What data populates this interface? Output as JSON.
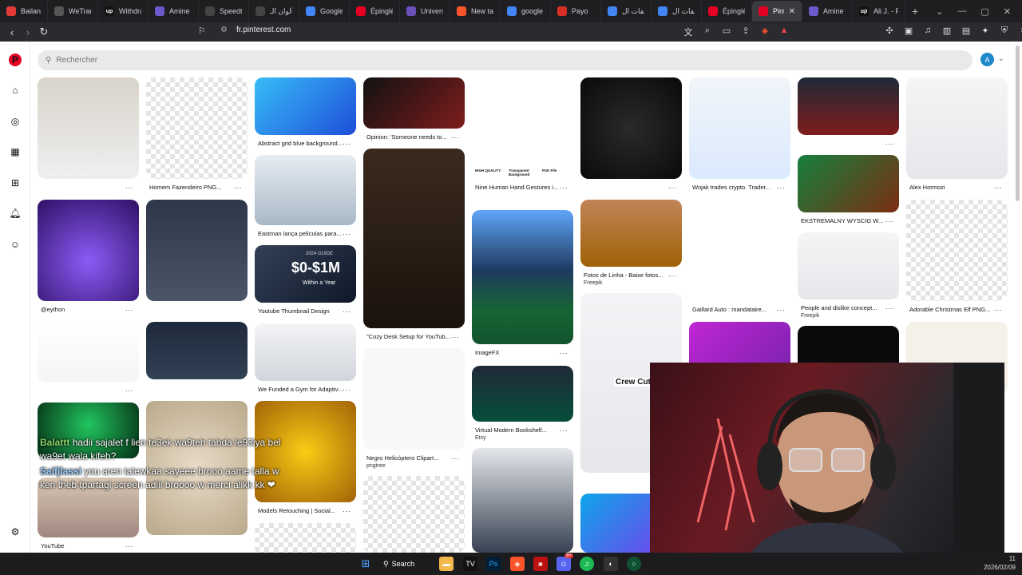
{
  "browser": {
    "tabs": [
      {
        "title": "Bailand",
        "color": "#e53935"
      },
      {
        "title": "WeTrans",
        "color": "#555"
      },
      {
        "title": "Withdra",
        "color": "#111",
        "icon": "up"
      },
      {
        "title": "Amine D",
        "color": "#6a5acd"
      },
      {
        "title": "Speedte",
        "color": "#444"
      },
      {
        "title": "ألوان الـ",
        "color": "#444"
      },
      {
        "title": "Google",
        "color": "#4285f4"
      },
      {
        "title": "Épinglé",
        "color": "#e60023"
      },
      {
        "title": "Univers",
        "color": "#6b4fbb"
      },
      {
        "title": "New tab",
        "color": "#fb542b"
      },
      {
        "title": "google t",
        "color": "#4285f4"
      },
      {
        "title": "Payo",
        "color": "#d93025"
      },
      {
        "title": "ملفات ال",
        "color": "#4285f4"
      },
      {
        "title": "ملفات ال",
        "color": "#4285f4"
      },
      {
        "title": "Épinglé",
        "color": "#e60023"
      },
      {
        "title": "Pint",
        "color": "#e60023",
        "active": true
      },
      {
        "title": "Amine D",
        "color": "#6a5acd"
      },
      {
        "title": "Ali J. - F",
        "color": "#111",
        "icon": "up"
      }
    ],
    "url": "fr.pinterest.com",
    "shield_badge": "1"
  },
  "pinterest": {
    "search_placeholder": "Rechercher",
    "avatar_letter": "A",
    "more_label": "...",
    "pins": [
      {
        "caption": "",
        "sub": ""
      },
      {
        "caption": "Homem Fazendeiro PNG...",
        "sub": ""
      },
      {
        "caption": "@eython",
        "sub": ""
      },
      {
        "caption": "",
        "sub": ""
      },
      {
        "caption": "",
        "sub": ""
      },
      {
        "caption": "YouTube",
        "sub": ""
      },
      {
        "caption": "",
        "sub": ""
      },
      {
        "caption": "",
        "sub": ""
      },
      {
        "caption": "",
        "sub": ""
      },
      {
        "caption": "Abstract grid blue background...",
        "sub": ""
      },
      {
        "caption": "Eastman lança películas para...",
        "sub": ""
      },
      {
        "caption": "Youtube Thumbnail Design",
        "sub": ""
      },
      {
        "caption": "We Funded a Gym for Adaptiv...",
        "sub": ""
      },
      {
        "caption": "Models Retouching | Social...",
        "sub": ""
      },
      {
        "caption": "",
        "sub": ""
      },
      {
        "caption": "Opinion: 'Someone needs to...",
        "sub": ""
      },
      {
        "caption": "\"Cozy Desk Setup for YouTub...",
        "sub": ""
      },
      {
        "caption": "Negro Helicóptero Clipart...",
        "sub": "pngtree"
      },
      {
        "caption": "",
        "sub": ""
      },
      {
        "caption": "Nine Human Hand Gestures i...",
        "sub": ""
      },
      {
        "caption": "ImageFX",
        "sub": ""
      },
      {
        "caption": "Virtual Modern Bookshelf...",
        "sub": "Etsy"
      },
      {
        "caption": "",
        "sub": ""
      },
      {
        "caption": "",
        "sub": ""
      },
      {
        "caption": "Fotos de Linha - Baixe fotos...",
        "sub": "Freepik"
      },
      {
        "caption": "",
        "sub": ""
      },
      {
        "caption": "",
        "sub": ""
      },
      {
        "caption": "Wojak trades crypto. Trader...",
        "sub": ""
      },
      {
        "caption": "Gaillard Auto : mandataire...",
        "sub": ""
      },
      {
        "caption": "",
        "sub": ""
      },
      {
        "caption": "",
        "sub": ""
      },
      {
        "caption": "EKSTREMALNY WYSCIG W...",
        "sub": ""
      },
      {
        "caption": "People and dislike concept...",
        "sub": "Freepik"
      },
      {
        "caption": "",
        "sub": ""
      },
      {
        "caption": "Alex Hormozi",
        "sub": ""
      },
      {
        "caption": "Adorable Christmas Elf PNG...",
        "sub": ""
      },
      {
        "caption": "",
        "sub": ""
      }
    ],
    "image_texts": {
      "thumbnail_guide": "2024 GUIDE",
      "thumbnail_money": "$0-$1M",
      "thumbnail_sub": "Within a Year",
      "crew_cut": "Crew Cut",
      "hands_labels": [
        "HIGH QUALITY",
        "Transparent Background",
        "PSD File"
      ]
    }
  },
  "stream_chat": [
    {
      "user": "Balattt",
      "msg": "hadii sajalet f lien te3ek wa9teh tabda le93iya bel"
    },
    {
      "user": "",
      "msg": "wa9et wala kifeh?"
    },
    {
      "user": "Saifjlassi",
      "msg": "you aren talewkaa sayeee brooo aame talla w"
    },
    {
      "user": "",
      "msg": "ken theb tpartagi screen adiii broooo w merci alikk kk ❤"
    }
  ],
  "taskbar": {
    "search_label": "Search",
    "discord_badge": "9+",
    "clock_time": "11",
    "clock_date": "2026/02/09"
  }
}
